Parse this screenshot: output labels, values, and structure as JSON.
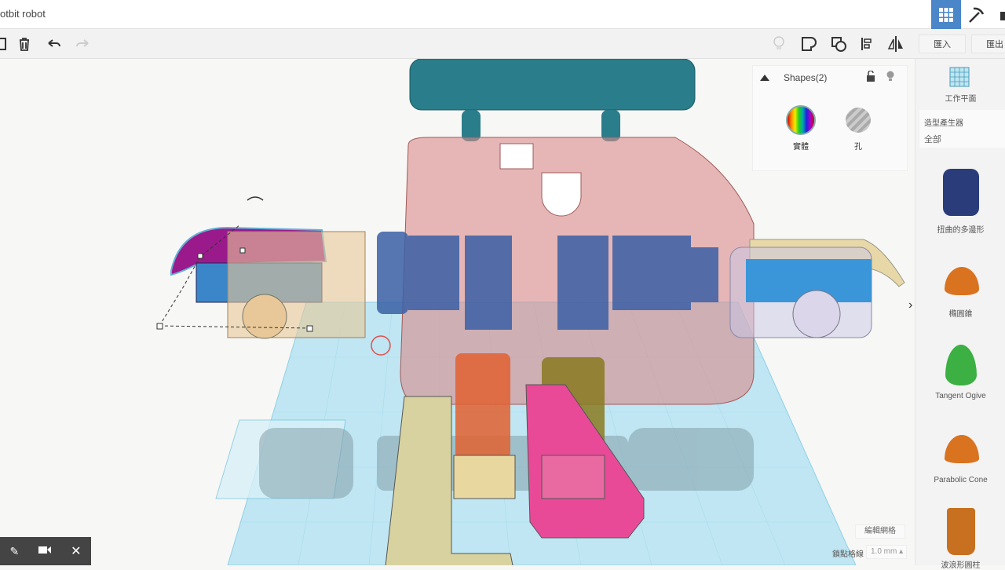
{
  "app": {
    "title": "otbit robot"
  },
  "toolbar": {
    "import_label": "匯入",
    "export_label": "匯出"
  },
  "shapes_panel": {
    "title": "Shapes(2)",
    "solid_label": "實體",
    "hole_label": "孔"
  },
  "sidebar": {
    "workplane_label": "工作平面",
    "category_title": "造型產生器",
    "category_value": "全部",
    "items": [
      {
        "label": "扭曲的多邊形",
        "color": "#2a3d7a"
      },
      {
        "label": "橢圓錐",
        "color": "#d9731f"
      },
      {
        "label": "Tangent Ogive",
        "color": "#3cb043"
      },
      {
        "label": "Parabolic Cone",
        "color": "#d9731f"
      },
      {
        "label": "波浪形圓柱",
        "color": "#c7701f"
      }
    ]
  },
  "grid": {
    "edit_grid_label": "編輯網格",
    "snap_label": "鎖點格線",
    "snap_value": "1.0 mm ▴"
  },
  "colors": {
    "accent": "#4a86c8",
    "workplane": "#bfe6f2"
  }
}
